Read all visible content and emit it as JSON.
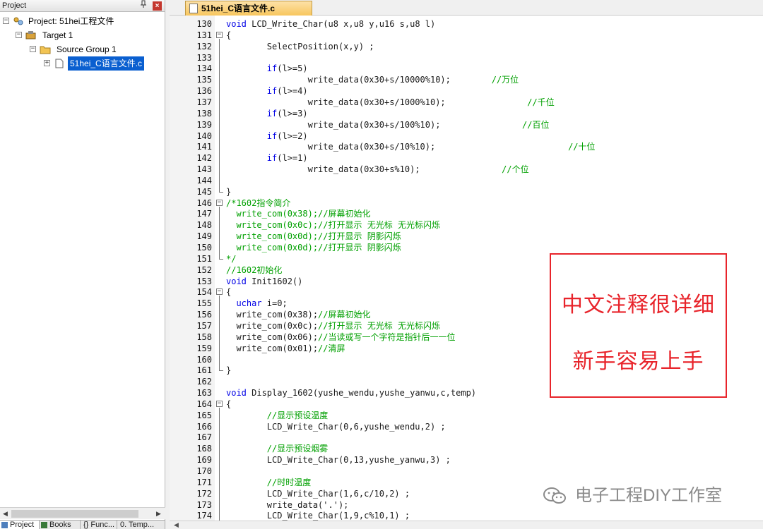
{
  "project_panel": {
    "title": "Project",
    "pin_glyph": "ᵖ",
    "close_glyph": "x",
    "tree": [
      {
        "label": "Project: 51hei工程文件",
        "icon": "project-icon",
        "expander": "-"
      },
      {
        "label": "Target 1",
        "icon": "target-icon",
        "expander": "-"
      },
      {
        "label": "Source Group 1",
        "icon": "folder-icon",
        "expander": "-"
      },
      {
        "label": "51hei_C语言文件.c",
        "icon": "file-icon",
        "expander": "+"
      }
    ],
    "bottom_tabs": [
      {
        "label": "Project"
      },
      {
        "label": "Books"
      },
      {
        "label": "{} Func..."
      },
      {
        "label": "0. Temp..."
      }
    ]
  },
  "editor": {
    "tab_label": "51hei_C语言文件.c",
    "lines": [
      {
        "n": "130",
        "t": "void LCD_Write_Char(u8 x,u8 y,u16 s,u8 l)",
        "c": "code"
      },
      {
        "n": "131",
        "t": "{",
        "c": "code"
      },
      {
        "n": "132",
        "t": "        SelectPosition(x,y) ;",
        "c": "code"
      },
      {
        "n": "133",
        "t": "",
        "c": "code"
      },
      {
        "n": "134",
        "t": "        if(l>=5)",
        "c": "code"
      },
      {
        "n": "135",
        "t": "                write_data(0x30+s/10000%10);        //万位",
        "c": "code"
      },
      {
        "n": "136",
        "t": "        if(l>=4)",
        "c": "code"
      },
      {
        "n": "137",
        "t": "                write_data(0x30+s/1000%10);                //千位",
        "c": "code"
      },
      {
        "n": "138",
        "t": "        if(l>=3)",
        "c": "code"
      },
      {
        "n": "139",
        "t": "                write_data(0x30+s/100%10);                //百位",
        "c": "code"
      },
      {
        "n": "140",
        "t": "        if(l>=2)",
        "c": "code"
      },
      {
        "n": "141",
        "t": "                write_data(0x30+s/10%10);                          //十位",
        "c": "code"
      },
      {
        "n": "142",
        "t": "        if(l>=1)",
        "c": "code"
      },
      {
        "n": "143",
        "t": "                write_data(0x30+s%10);                //个位",
        "c": "code"
      },
      {
        "n": "144",
        "t": "",
        "c": "code"
      },
      {
        "n": "145",
        "t": "}",
        "c": "code"
      },
      {
        "n": "146",
        "t": "/*1602指令简介",
        "c": "comment"
      },
      {
        "n": "147",
        "t": "  write_com(0x38);//屏幕初始化",
        "c": "comment"
      },
      {
        "n": "148",
        "t": "  write_com(0x0c);//打开显示 无光标 无光标闪烁",
        "c": "comment"
      },
      {
        "n": "149",
        "t": "  write_com(0x0d);//打开显示 阴影闪烁",
        "c": "comment"
      },
      {
        "n": "150",
        "t": "  write_com(0x0d);//打开显示 阴影闪烁",
        "c": "comment"
      },
      {
        "n": "151",
        "t": "*/",
        "c": "comment"
      },
      {
        "n": "152",
        "t": "//1602初始化",
        "c": "comment"
      },
      {
        "n": "153",
        "t": "void Init1602()",
        "c": "code"
      },
      {
        "n": "154",
        "t": "{",
        "c": "code"
      },
      {
        "n": "155",
        "t": "  uchar i=0;",
        "c": "code"
      },
      {
        "n": "156",
        "t": "  write_com(0x38);//屏幕初始化",
        "c": "code"
      },
      {
        "n": "157",
        "t": "  write_com(0x0c);//打开显示 无光标 无光标闪烁",
        "c": "code"
      },
      {
        "n": "158",
        "t": "  write_com(0x06);//当读或写一个字符是指针后一一位",
        "c": "code"
      },
      {
        "n": "159",
        "t": "  write_com(0x01);//清屏",
        "c": "code"
      },
      {
        "n": "160",
        "t": "",
        "c": "code"
      },
      {
        "n": "161",
        "t": "}",
        "c": "code"
      },
      {
        "n": "162",
        "t": "",
        "c": "code"
      },
      {
        "n": "163",
        "t": "void Display_1602(yushe_wendu,yushe_yanwu,c,temp)",
        "c": "code"
      },
      {
        "n": "164",
        "t": "{",
        "c": "code"
      },
      {
        "n": "165",
        "t": "        //显示预设温度",
        "c": "comment"
      },
      {
        "n": "166",
        "t": "        LCD_Write_Char(0,6,yushe_wendu,2) ;",
        "c": "code"
      },
      {
        "n": "167",
        "t": "",
        "c": "code"
      },
      {
        "n": "168",
        "t": "        //显示预设烟雾",
        "c": "comment"
      },
      {
        "n": "169",
        "t": "        LCD_Write_Char(0,13,yushe_yanwu,3) ;",
        "c": "code"
      },
      {
        "n": "170",
        "t": "",
        "c": "code"
      },
      {
        "n": "171",
        "t": "        //时时温度",
        "c": "comment"
      },
      {
        "n": "172",
        "t": "        LCD_Write_Char(1,6,c/10,2) ;",
        "c": "code"
      },
      {
        "n": "173",
        "t": "        write_data('.');",
        "c": "code"
      },
      {
        "n": "174",
        "t": "        LCD_Write_Char(1,9,c%10,1) ;",
        "c": "code"
      }
    ]
  },
  "annotation": {
    "line1": "中文注释很详细",
    "line2": "新手容易上手"
  },
  "watermark": {
    "text": "电子工程DIY工作室"
  },
  "colors": {
    "keyword": "#0000e6",
    "comment": "#00a000",
    "annotation": "#e8242b",
    "selection": "#0a5fd0",
    "tab": "#f7c65e"
  }
}
